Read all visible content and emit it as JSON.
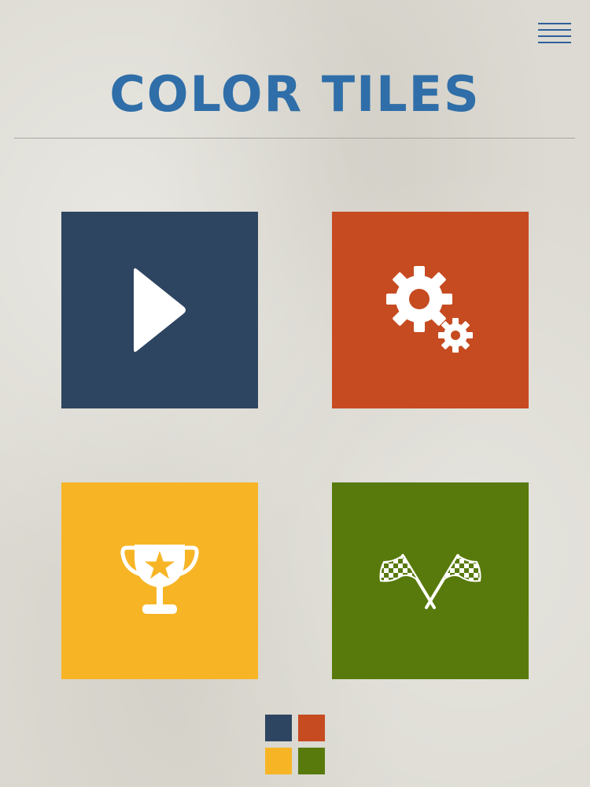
{
  "header": {
    "title": "COLOR TILES",
    "menu_icon": "hamburger-menu-icon"
  },
  "tiles": [
    {
      "id": "play",
      "icon": "play-icon",
      "color": "#2d4560"
    },
    {
      "id": "settings",
      "icon": "gears-icon",
      "color": "#c64b21"
    },
    {
      "id": "achievements",
      "icon": "trophy-star-icon",
      "color": "#f7b526"
    },
    {
      "id": "race",
      "icon": "checkered-flags-icon",
      "color": "#587a0c"
    }
  ],
  "colors": {
    "title": "#2f6ea8",
    "background": "#dcdad2"
  }
}
